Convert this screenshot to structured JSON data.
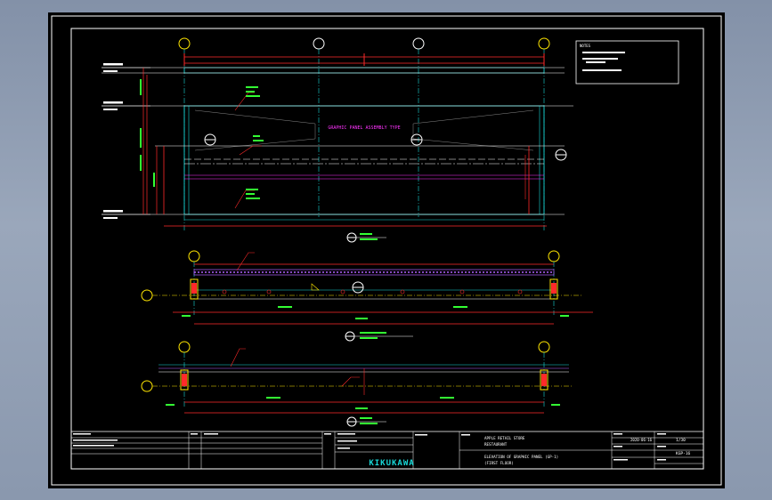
{
  "colors": {
    "background": "#000000",
    "frame": "#ffffff",
    "grid_cyan": "#18d8d8",
    "accent_red": "#ff2a2a",
    "annotation_magenta": "#ff33ff",
    "label_yellow": "#ffe600",
    "dim_green": "#33ff33",
    "band_purple": "#b060ff"
  },
  "icons": [
    "grid-bubble-icon",
    "section-marker-icon",
    "elevation-marker-icon"
  ],
  "drawing": {
    "annotation": "GRAPHIC PANEL ASSEMBLY TYPE",
    "notes_title": "NOTES"
  },
  "title_block": {
    "company": "KIKUKAWA",
    "project_title": "APPLE RETAIL STORE",
    "project_subtitle": "RESTAURANT",
    "sheet_title_line1": "ELEVATION OF GRAPHIC PANEL (GP-1)",
    "sheet_title_line2": "(FIRST FLOOR)",
    "date": "2020-06-16",
    "scale": "1/30",
    "drawing_no": "KGP-16"
  }
}
